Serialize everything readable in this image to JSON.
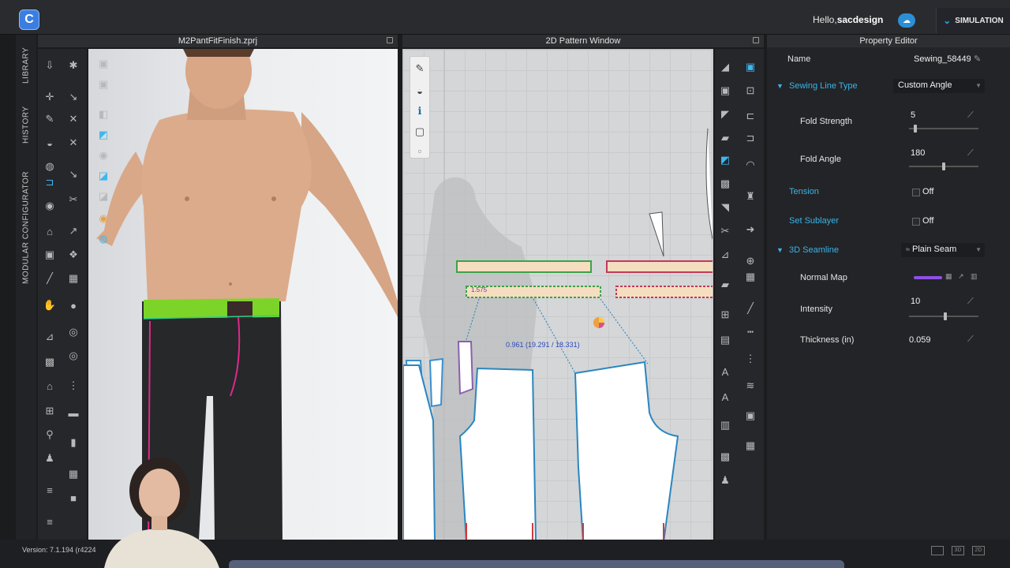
{
  "app": {
    "logo_glyph": "C"
  },
  "topbar": {
    "greeting_prefix": "Hello,",
    "user": "sacdesign",
    "simulation_label": "SIMULATION"
  },
  "left_tabs": [
    "LIBRARY",
    "HISTORY",
    "MODULAR CONFIGURATOR"
  ],
  "panels": {
    "viewport3d_title": "M2PantFitFinish.zprj",
    "pattern_title": "2D Pattern Window",
    "property_title": "Property Editor"
  },
  "pattern": {
    "measure_label": "0.961 (19.291 / 18.331)",
    "small_label": "1.575"
  },
  "properties": {
    "name_label": "Name",
    "name_value": "Sewing_58449",
    "sewing_line_type_label": "Sewing Line Type",
    "sewing_line_type_value": "Custom Angle",
    "fold_strength_label": "Fold Strength",
    "fold_strength_value": "5",
    "fold_angle_label": "Fold Angle",
    "fold_angle_value": "180",
    "tension_label": "Tension",
    "tension_value": "Off",
    "set_sublayer_label": "Set Sublayer",
    "set_sublayer_value": "Off",
    "seamline_label": "3D Seamline",
    "seamline_value": "Plain Seam",
    "normal_map_label": "Normal Map",
    "intensity_label": "Intensity",
    "intensity_value": "10",
    "thickness_label": "Thickness (in)",
    "thickness_value": "0.059"
  },
  "footer": {
    "version": "Version: 7.1.194 (r4224"
  },
  "colors": {
    "accent": "#38b4ea",
    "normal_map": "#8e4fe6",
    "pattern_bg": "#d4d6d8"
  }
}
